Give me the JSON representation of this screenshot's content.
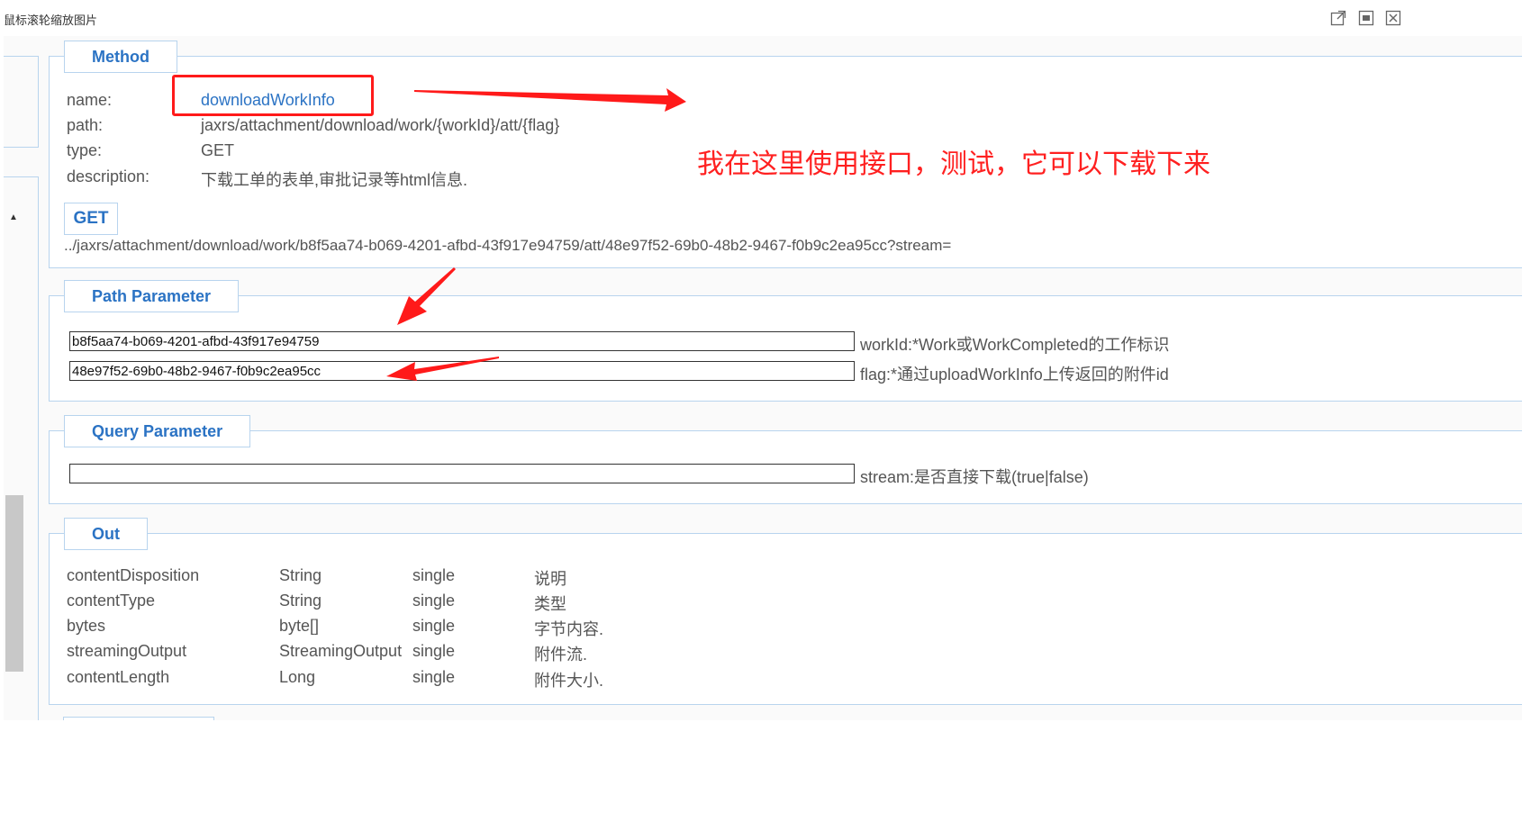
{
  "window": {
    "title": "鼠标滚轮缩放图片"
  },
  "method": {
    "legend": "Method",
    "name_label": "name:",
    "name_value": "downloadWorkInfo",
    "path_label": "path:",
    "path_value": "jaxrs/attachment/download/work/{workId}/att/{flag}",
    "type_label": "type:",
    "type_value": "GET",
    "description_label": "description:",
    "description_value": "下载工单的表单,审批记录等html信息.",
    "http_method": "GET",
    "url": "../jaxrs/attachment/download/work/b8f5aa74-b069-4201-afbd-43f917e94759/att/48e97f52-69b0-48b2-9467-f0b9c2ea95cc?stream="
  },
  "path_parameter": {
    "legend": "Path Parameter",
    "params": [
      {
        "value": "b8f5aa74-b069-4201-afbd-43f917e94759",
        "desc": "workId:*Work或WorkCompleted的工作标识"
      },
      {
        "value": "48e97f52-69b0-48b2-9467-f0b9c2ea95cc",
        "desc": "flag:*通过uploadWorkInfo上传返回的附件id"
      }
    ]
  },
  "query_parameter": {
    "legend": "Query Parameter",
    "params": [
      {
        "value": "",
        "desc": "stream:是否直接下载(true|false)"
      }
    ]
  },
  "out": {
    "legend": "Out",
    "rows": [
      [
        "contentDisposition",
        "String",
        "single",
        "说明"
      ],
      [
        "contentType",
        "String",
        "single",
        "类型"
      ],
      [
        "bytes",
        "byte[]",
        "single",
        "字节内容."
      ],
      [
        "streamingOutput",
        "StreamingOutput",
        "single",
        "附件流."
      ],
      [
        "contentLength",
        "Long",
        "single",
        "附件大小."
      ]
    ]
  },
  "annotation": {
    "text": "我在这里使用接口，测试，它可以下载下来",
    "color": "#ff2020"
  },
  "colors": {
    "accent": "#2b73c4",
    "border": "#b8d4ee",
    "annotation_red": "#ff1a1a"
  },
  "icons": {
    "popout": "external-link-icon",
    "maximize": "maximize-icon",
    "close": "close-icon"
  }
}
